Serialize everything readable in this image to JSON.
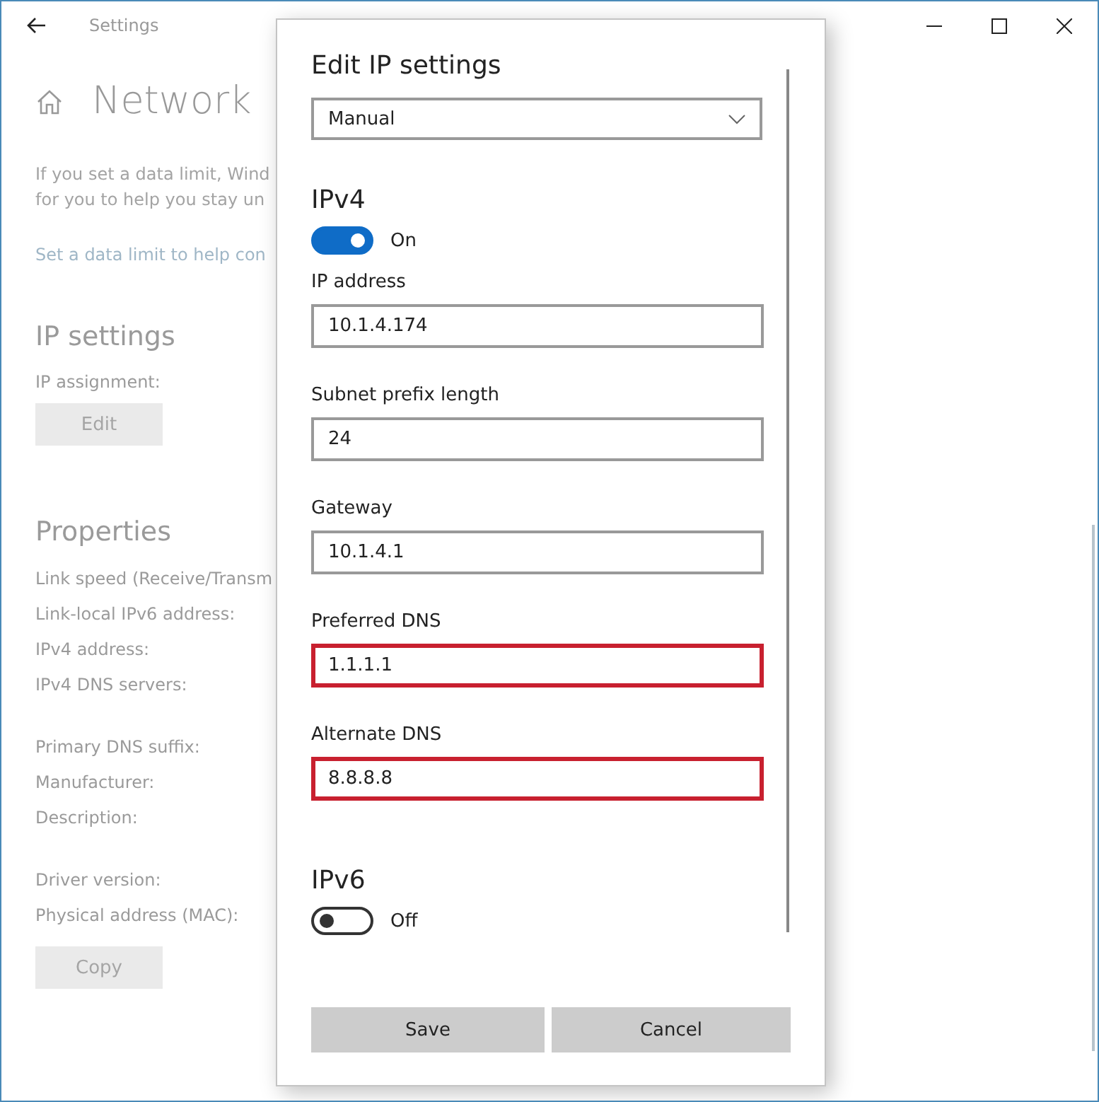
{
  "window": {
    "title": "Settings"
  },
  "page": {
    "title": "Network",
    "intro": [
      "If you set a data limit, Wind",
      "for you to help you stay un"
    ],
    "link": "Set a data limit to help con",
    "ip_settings": {
      "heading": "IP settings",
      "label": "IP assignment:",
      "button": "Edit"
    },
    "properties": {
      "heading": "Properties",
      "groups": [
        [
          "Link speed (Receive/Transm",
          "Link-local IPv6 address:",
          "IPv4 address:",
          "IPv4 DNS servers:"
        ],
        [
          "Primary DNS suffix:",
          "Manufacturer:",
          "Description:"
        ],
        [
          "Driver version:",
          "Physical address (MAC):"
        ]
      ],
      "button": "Copy"
    }
  },
  "dialog": {
    "title": "Edit IP settings",
    "mode": "Manual",
    "sections": [
      {
        "heading": "IPv4",
        "on": true,
        "state_label": "On",
        "fields": [
          {
            "label": "IP address",
            "value": "10.1.4.174",
            "highlighted": false
          },
          {
            "label": "Subnet prefix length",
            "value": "24",
            "highlighted": false
          },
          {
            "label": "Gateway",
            "value": "10.1.4.1",
            "highlighted": false
          },
          {
            "label": "Preferred DNS",
            "value": "1.1.1.1",
            "highlighted": true
          },
          {
            "label": "Alternate DNS",
            "value": "8.8.8.8",
            "highlighted": true
          }
        ]
      },
      {
        "heading": "IPv6",
        "on": false,
        "state_label": "Off"
      }
    ],
    "buttons": [
      "Save",
      "Cancel"
    ]
  }
}
